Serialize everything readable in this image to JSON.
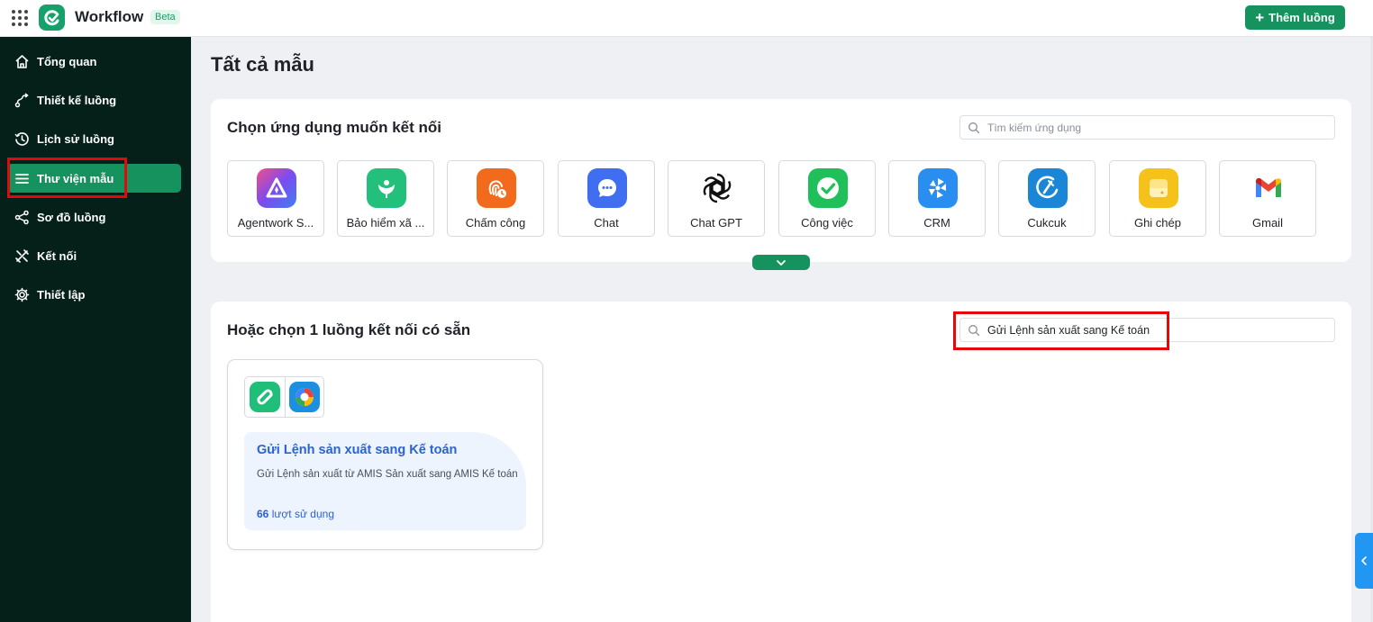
{
  "header": {
    "brand": "Workflow",
    "beta": "Beta",
    "add_flow": "Thêm luồng"
  },
  "sidebar": {
    "items": [
      {
        "label": "Tổng quan",
        "icon": "home-icon"
      },
      {
        "label": "Thiết kế luồng",
        "icon": "flow-design-icon"
      },
      {
        "label": "Lịch sử luồng",
        "icon": "history-icon"
      },
      {
        "label": "Thư viện mẫu",
        "icon": "menu-list-icon",
        "active": true
      },
      {
        "label": "Sơ đồ luồng",
        "icon": "share-graph-icon"
      },
      {
        "label": "Kết nối",
        "icon": "connect-tools-icon"
      },
      {
        "label": "Thiết lập",
        "icon": "gear-icon"
      }
    ]
  },
  "main": {
    "title": "Tất cả mẫu",
    "apps_section": {
      "title": "Chọn ứng dụng muốn kết nối",
      "search_placeholder": "Tìm kiếm ứng dụng",
      "apps": [
        {
          "label": "Agentwork S...",
          "icon": "agentwork-icon",
          "color": "#7b4cf0"
        },
        {
          "label": "Bảo hiểm xã ...",
          "icon": "insurance-icon",
          "color": "#22c07a"
        },
        {
          "label": "Chấm công",
          "icon": "fingerprint-icon",
          "color": "#f26a1b"
        },
        {
          "label": "Chat",
          "icon": "chat-icon",
          "color": "#3f6ff0"
        },
        {
          "label": "Chat GPT",
          "icon": "chatgpt-icon",
          "color": "#111111"
        },
        {
          "label": "Công việc",
          "icon": "task-check-icon",
          "color": "#1fbf5a"
        },
        {
          "label": "CRM",
          "icon": "crm-icon",
          "color": "#2a8ef0"
        },
        {
          "label": "Cukcuk",
          "icon": "cukcuk-icon",
          "color": "#1b86d6"
        },
        {
          "label": "Ghi chép",
          "icon": "note-icon",
          "color": "#f5c21b"
        },
        {
          "label": "Gmail",
          "icon": "gmail-icon",
          "color": "#ea4335"
        }
      ]
    },
    "flows_section": {
      "title": "Hoặc chọn 1 luồng kết nối có sẵn",
      "search_value": "Gửi Lệnh sản xuất sang Kế toán",
      "templates": [
        {
          "title": "Gửi Lệnh sản xuất sang Kế toán",
          "description": "Gửi Lệnh sản xuất từ AMIS Sản xuất sang AMIS Kế toán",
          "usage_count": "66",
          "usage_label": "lượt sử dụng",
          "icons": [
            "amis-production-icon",
            "amis-accounting-icon"
          ]
        }
      ]
    }
  }
}
